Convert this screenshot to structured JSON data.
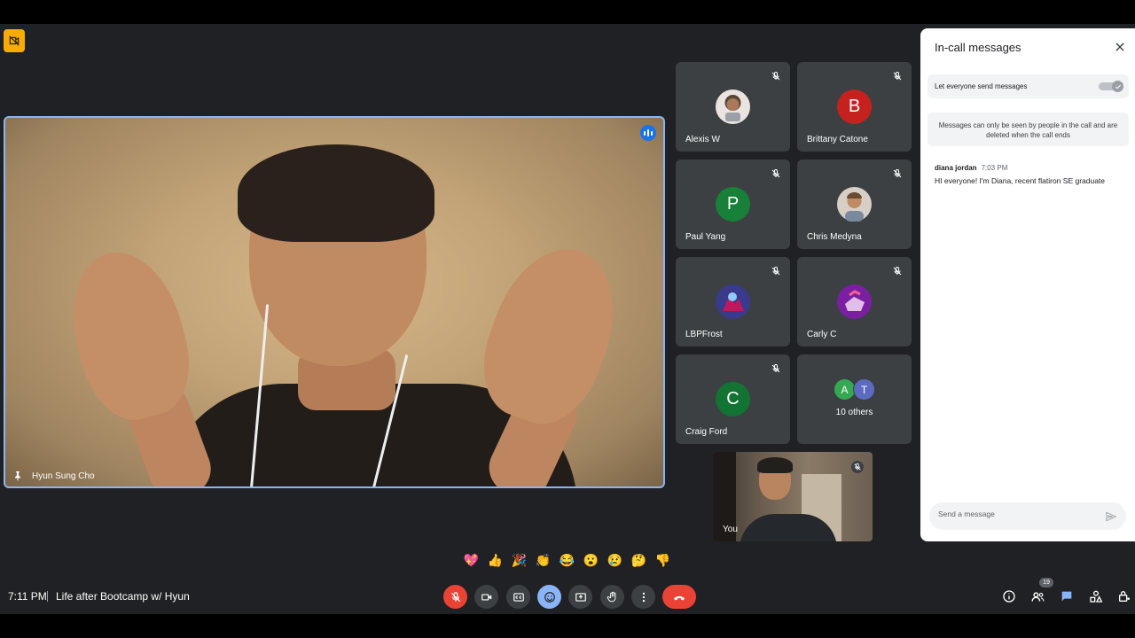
{
  "meeting": {
    "time": "7:11 PM",
    "title": "Life after Bootcamp w/ Hyun",
    "participant_count": "19"
  },
  "main_speaker": {
    "name": "Hyun Sung Cho"
  },
  "tiles": [
    {
      "name": "Alexis W",
      "avatar_type": "photo",
      "avatar_color": "#6d5a4a"
    },
    {
      "name": "Brittany Catone",
      "avatar_type": "letter",
      "letter": "B",
      "avatar_color": "#c5221f"
    },
    {
      "name": "Paul Yang",
      "avatar_type": "letter",
      "letter": "P",
      "avatar_color": "#188038"
    },
    {
      "name": "Chris Medyna",
      "avatar_type": "photo",
      "avatar_color": "#8a6f5a"
    },
    {
      "name": "LBPFrost",
      "avatar_type": "photo",
      "avatar_color": "#5a4fa0"
    },
    {
      "name": "Carly C",
      "avatar_type": "photo",
      "avatar_color": "#9c27b0"
    },
    {
      "name": "Craig Ford",
      "avatar_type": "letter",
      "letter": "C",
      "avatar_color": "#137333"
    }
  ],
  "others": {
    "label": "10 others",
    "avatars": [
      {
        "letter": "A",
        "color": "#34a853"
      },
      {
        "letter": "T",
        "color": "#5c6bc0"
      }
    ]
  },
  "self_view": {
    "label": "You"
  },
  "panel": {
    "title": "In-call messages",
    "toggle_label": "Let everyone send messages",
    "toggle_on": true,
    "info": "Messages can only be seen by people in the call and are deleted when the call ends",
    "messages": [
      {
        "author": "diana jordan",
        "time": "7:03 PM",
        "text": "HI everyone! I'm Diana, recent flatiron SE graduate"
      }
    ],
    "input_placeholder": "Send a message"
  },
  "reactions": [
    "💖",
    "👍",
    "🎉",
    "👏",
    "😂",
    "😮",
    "😢",
    "🤔",
    "👎"
  ],
  "colors": {
    "accent": "#8ab4f8",
    "danger": "#ea4335",
    "surface": "#3c4043",
    "background": "#202124",
    "warning": "#f9ab00"
  }
}
